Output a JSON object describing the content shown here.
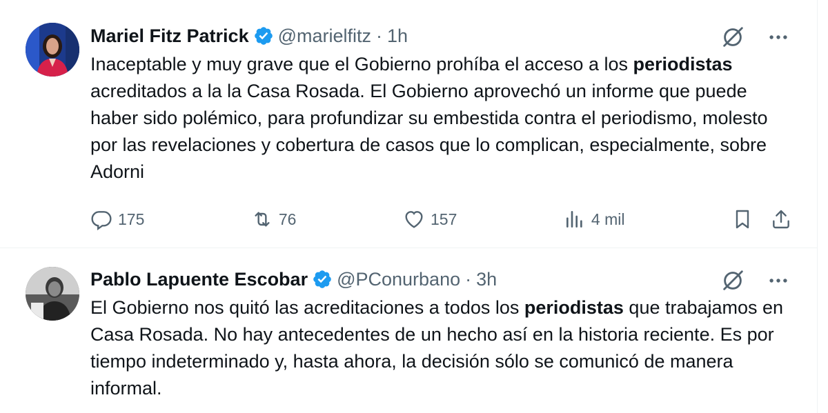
{
  "tweets": [
    {
      "name": "Mariel Fitz Patrick",
      "handle": "@marielfitz",
      "dot": "·",
      "time": "1h",
      "text_parts": [
        "Inaceptable y muy grave que el Gobierno prohíba el acceso a los ",
        "periodistas",
        " acreditados a la la Casa Rosada. El Gobierno aprovechó un informe que puede haber sido polémico, para profundizar su embestida contra el periodismo, molesto por las revelaciones y cobertura de casos que lo complican, especialmente, sobre Adorni"
      ],
      "stats": {
        "replies": "175",
        "reposts": "76",
        "likes": "157",
        "views": "4 mil"
      },
      "icons": [
        "grok-icon",
        "more-icon",
        "reply-icon",
        "repost-icon",
        "like-icon",
        "views-icon",
        "bookmark-icon",
        "share-icon"
      ]
    },
    {
      "name": "Pablo Lapuente Escobar",
      "handle": "@PConurbano",
      "dot": "·",
      "time": "3h",
      "text_parts": [
        "El Gobierno nos quitó las acreditaciones a todos los ",
        "periodistas",
        " que trabajamos en Casa Rosada. No hay antecedentes de un hecho así en la historia reciente. Es por tiempo indeterminado y, hasta ahora, la decisión sólo se comunicó de manera informal."
      ],
      "icons": [
        "grok-icon",
        "more-icon"
      ]
    }
  ],
  "colors": {
    "verified": "#1d9bf0",
    "muted": "#536471",
    "text": "#0f1419",
    "divider": "#eff3f4"
  }
}
